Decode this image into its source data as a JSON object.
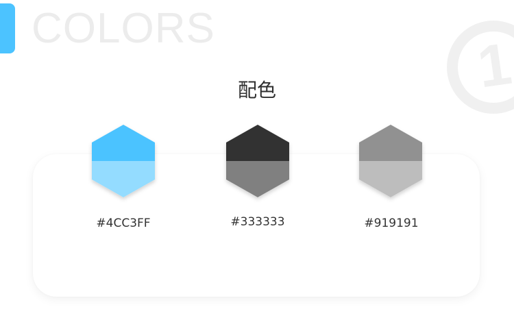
{
  "header": {
    "bg_heading": "COLORS",
    "accent_color": "#4CC3FF"
  },
  "section": {
    "title": "配色"
  },
  "watermark": {
    "icon": "circled-number-one-icon",
    "glyph": "1"
  },
  "palette": [
    {
      "label": "#4CC3FF",
      "top_color": "#4CC3FF",
      "bottom_color": "#94DCFF"
    },
    {
      "label": "#333333",
      "top_color": "#333333",
      "bottom_color": "#808080"
    },
    {
      "label": "#919191",
      "top_color": "#919191",
      "bottom_color": "#BDBDBD"
    }
  ]
}
